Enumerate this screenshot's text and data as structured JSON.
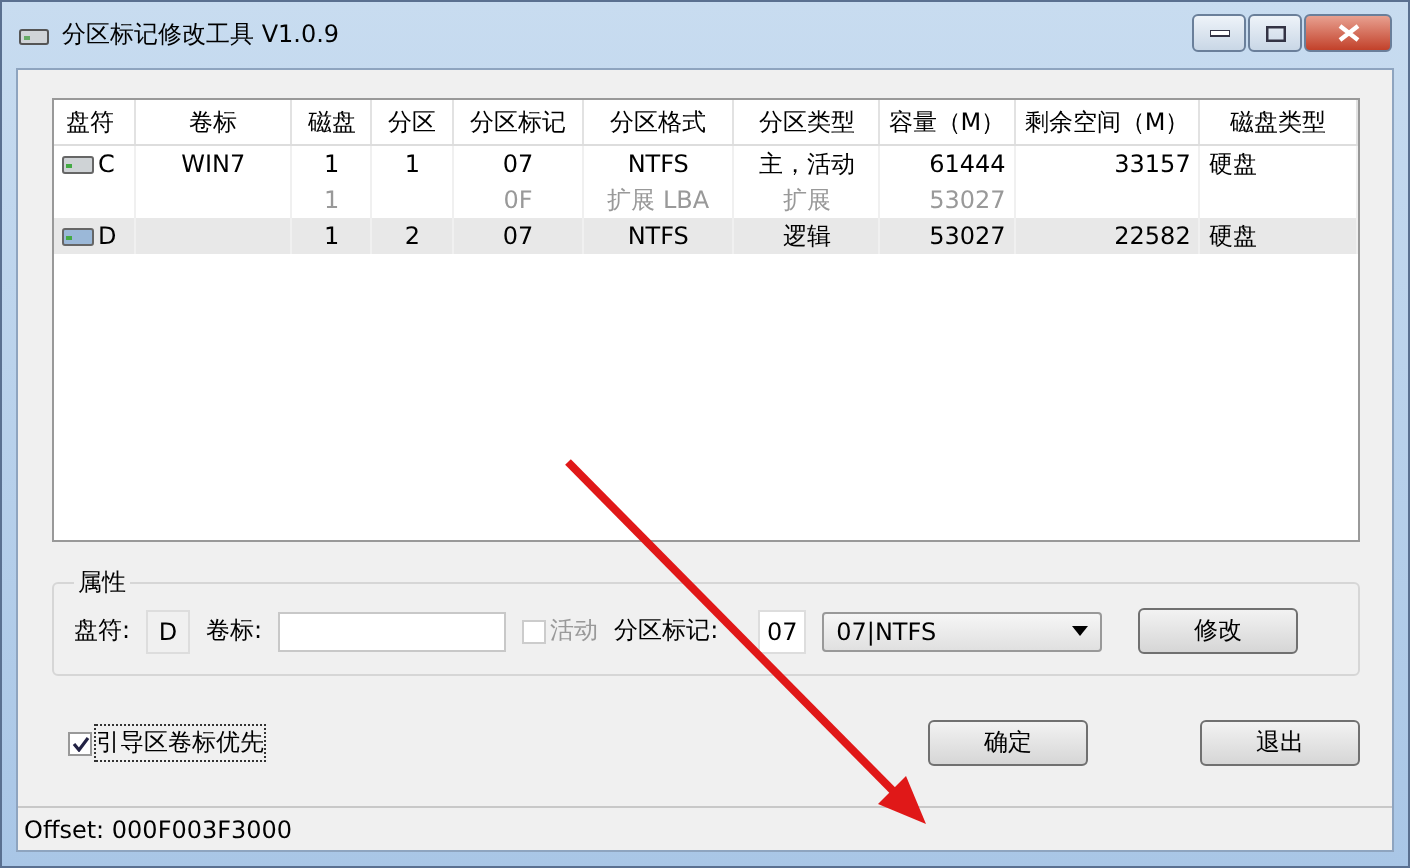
{
  "window": {
    "title": "分区标记修改工具 V1.0.9"
  },
  "table": {
    "columns": [
      "盘符",
      "卷标",
      "磁盘",
      "分区",
      "分区标记",
      "分区格式",
      "分区类型",
      "容量（M）",
      "剩余空间（M）",
      "磁盘类型"
    ],
    "rows": [
      {
        "kind": "partition",
        "selected": false,
        "drive": "C",
        "label": "WIN7",
        "disk": "1",
        "part": "1",
        "mark": "07",
        "format": "NTFS",
        "type": "主，活动",
        "size": "61444",
        "free": "33157",
        "disk_type": "硬盘"
      },
      {
        "kind": "extended",
        "selected": false,
        "disk": "1",
        "mark": "0F",
        "format": "扩展 LBA",
        "type": "扩展",
        "size": "53027"
      },
      {
        "kind": "partition",
        "selected": true,
        "drive": "D",
        "disk": "1",
        "part": "2",
        "mark": "07",
        "format": "NTFS",
        "type": "逻辑",
        "size": "53027",
        "free": "22582",
        "disk_type": "硬盘"
      }
    ]
  },
  "properties": {
    "title": "属性",
    "drive_label": "盘符:",
    "drive_value": "D",
    "volume_label": "卷标:",
    "active": {
      "label": "活动",
      "checked": false,
      "disabled": true
    },
    "mark_label": "分区标记:",
    "mark_value": "07",
    "format_select": "07|NTFS",
    "modify_button": "修改"
  },
  "boot_label_priority": {
    "label": "引导区卷标优先",
    "checked": true
  },
  "buttons": {
    "ok": "确定",
    "exit": "退出"
  },
  "status_bar": "Offset: 000F003F3000"
}
